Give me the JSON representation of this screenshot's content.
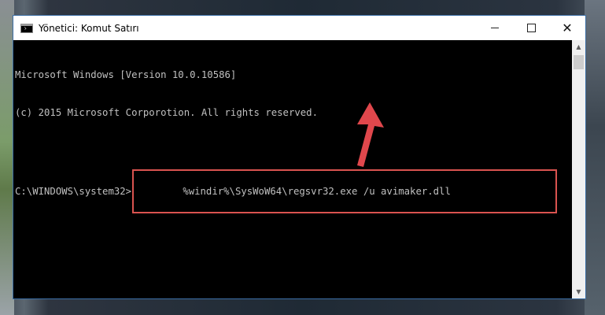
{
  "window": {
    "title": "Yönetici: Komut Satırı",
    "controls": {
      "minimize": "minimize",
      "maximize": "maximize",
      "close": "✕"
    }
  },
  "console": {
    "lines": [
      "Microsoft Windows [Version 10.0.10586]",
      "(c) 2015 Microsoft Corporotion. All rights reserved."
    ],
    "prompt": "C:\\WINDOWS\\system32>",
    "command": "%windir%\\SysWoW64\\regsvr32.exe /u avimaker.dll"
  },
  "annotation": {
    "highlight_color": "#d9534f",
    "arrow_color": "#e0474c",
    "arrow_icon": "up-arrow-icon"
  },
  "scrollbar": {
    "up_icon": "▲",
    "down_icon": "▼"
  }
}
